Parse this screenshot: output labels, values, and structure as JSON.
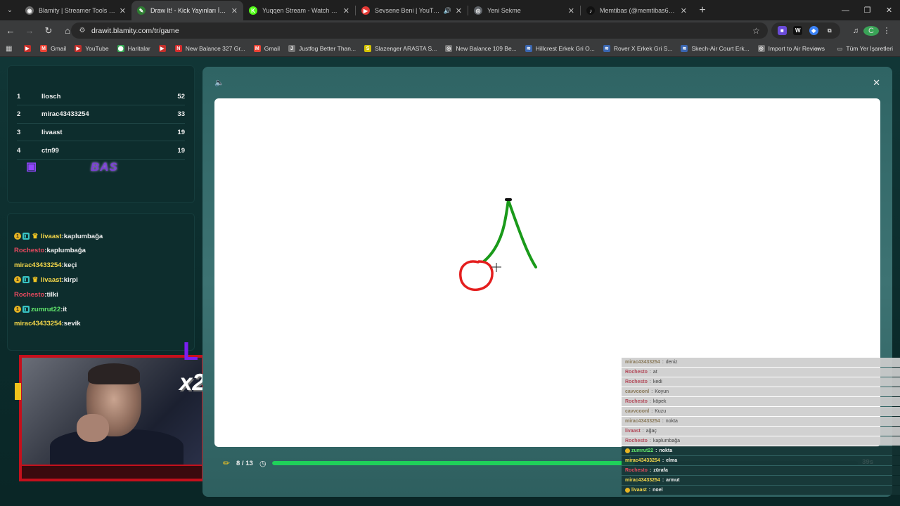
{
  "browser": {
    "tabs": [
      {
        "title": "Blamity | Streamer Tools & Party",
        "favicon_color": "#6c6c6c",
        "favicon_glyph": "◉",
        "active": false,
        "audio": false
      },
      {
        "title": "Draw It! - Kick Yayınları İçin Çizim",
        "favicon_color": "#2e7d32",
        "favicon_glyph": "✎",
        "active": true,
        "audio": false
      },
      {
        "title": "Yuqqen Stream - Watch Live on Kick",
        "favicon_color": "#53fc18",
        "favicon_glyph": "K",
        "active": false,
        "audio": false
      },
      {
        "title": "Sevsene Beni | YouTube Music",
        "favicon_color": "#e53935",
        "favicon_glyph": "▶",
        "active": false,
        "audio": true
      },
      {
        "title": "Yeni Sekme",
        "favicon_color": "#5f6368",
        "favicon_glyph": "◎",
        "active": false,
        "audio": false
      },
      {
        "title": "Memtibas (@memtibas6) | TikTok",
        "favicon_color": "#111111",
        "favicon_glyph": "♪",
        "active": false,
        "audio": false
      }
    ],
    "url": "drawit.blamity.com/tr/game",
    "bookmarks": [
      {
        "label": "",
        "color": "#c4302b",
        "glyph": "▶"
      },
      {
        "label": "Gmail",
        "color": "#ea4335",
        "glyph": "M"
      },
      {
        "label": "YouTube",
        "color": "#c4302b",
        "glyph": "▶"
      },
      {
        "label": "Haritalar",
        "color": "#34a853",
        "glyph": "⬤"
      },
      {
        "label": "",
        "color": "#c4302b",
        "glyph": "▶"
      },
      {
        "label": "New Balance 327 Gr...",
        "color": "#d62d2d",
        "glyph": "N"
      },
      {
        "label": "Gmail",
        "color": "#ea4335",
        "glyph": "M"
      },
      {
        "label": "Justfog Better Than...",
        "color": "#777777",
        "glyph": "J"
      },
      {
        "label": "Slazenger ARASTA S...",
        "color": "#d4c300",
        "glyph": "S"
      },
      {
        "label": "New Balance 109 Be...",
        "color": "#777777",
        "glyph": "◎"
      },
      {
        "label": "Hillcrest Erkek Gri O...",
        "color": "#3a66b0",
        "glyph": "≋"
      },
      {
        "label": "Rover X Erkek Gri S...",
        "color": "#3a66b0",
        "glyph": "≋"
      },
      {
        "label": "Skech-Air Court Erk...",
        "color": "#3a66b0",
        "glyph": "≋"
      },
      {
        "label": "Import to Air Reviews",
        "color": "#777777",
        "glyph": "◎"
      }
    ],
    "all_bookmarks_label": "Tüm Yer İşaretleri"
  },
  "leaderboard": [
    {
      "rank": "1",
      "name": "llosch",
      "score": "52"
    },
    {
      "rank": "2",
      "name": "mirac43433254",
      "score": "33"
    },
    {
      "rank": "3",
      "name": "livaast",
      "score": "19"
    },
    {
      "rank": "4",
      "name": "ctn99",
      "score": "19"
    }
  ],
  "brand_text": "BAS",
  "chat": [
    {
      "badges": [
        "gold",
        "blue",
        "crown"
      ],
      "user": "livaast",
      "color": "yellow",
      "message": ":kaplumbağa"
    },
    {
      "badges": [],
      "user": "Rochesto",
      "color": "red",
      "message": ":kaplumbağa"
    },
    {
      "badges": [],
      "user": "mirac43433254",
      "color": "yellow",
      "message": ":keçi"
    },
    {
      "badges": [
        "gold",
        "blue",
        "crown"
      ],
      "user": "livaast",
      "color": "yellow",
      "message": ":kirpi"
    },
    {
      "badges": [],
      "user": "Rochesto",
      "color": "red",
      "message": ":tilki"
    },
    {
      "badges": [
        "gold",
        "blue"
      ],
      "user": "zumrut22",
      "color": "green",
      "message": ":it"
    },
    {
      "badges": [],
      "user": "mirac43433254",
      "color": "yellow",
      "message": ":sevik"
    }
  ],
  "cam_overlay": {
    "multiplier": "x2",
    "letter": "L"
  },
  "game": {
    "round_label": "8 / 13",
    "progress": 0.62,
    "seconds_label": "39s"
  },
  "overlay_chat": [
    {
      "user": "mirac43433254",
      "message": "deniz",
      "style": "light",
      "color": "yellow"
    },
    {
      "user": "Rochesto",
      "message": "at",
      "style": "light",
      "color": "red"
    },
    {
      "user": "Rochesto",
      "message": "kedi",
      "style": "light",
      "color": "red"
    },
    {
      "user": "cavvcoonl",
      "message": "Koyun",
      "style": "light",
      "color": "yellow"
    },
    {
      "user": "Rochesto",
      "message": "köpek",
      "style": "light",
      "color": "red"
    },
    {
      "user": "cavvcoonl",
      "message": "Kuzu",
      "style": "light",
      "color": "yellow"
    },
    {
      "user": "mirac43433254",
      "message": "nokta",
      "style": "light",
      "color": "yellow"
    },
    {
      "user": "livaast",
      "message": "ağaç",
      "style": "light",
      "color": "red"
    },
    {
      "user": "Rochesto",
      "message": "kaplumbağa",
      "style": "light",
      "color": "red"
    },
    {
      "user": "zumrut22",
      "message": "nokta",
      "style": "dark",
      "color": "green"
    },
    {
      "user": "mirac43433254",
      "message": "elma",
      "style": "dark",
      "color": "yellow"
    },
    {
      "user": "Rochesto",
      "message": "zürafa",
      "style": "dark",
      "color": "red"
    },
    {
      "user": "mirac43433254",
      "message": "armut",
      "style": "dark",
      "color": "yellow"
    },
    {
      "user": "livaast",
      "message": "noel",
      "style": "dark",
      "color": "yellow"
    }
  ]
}
